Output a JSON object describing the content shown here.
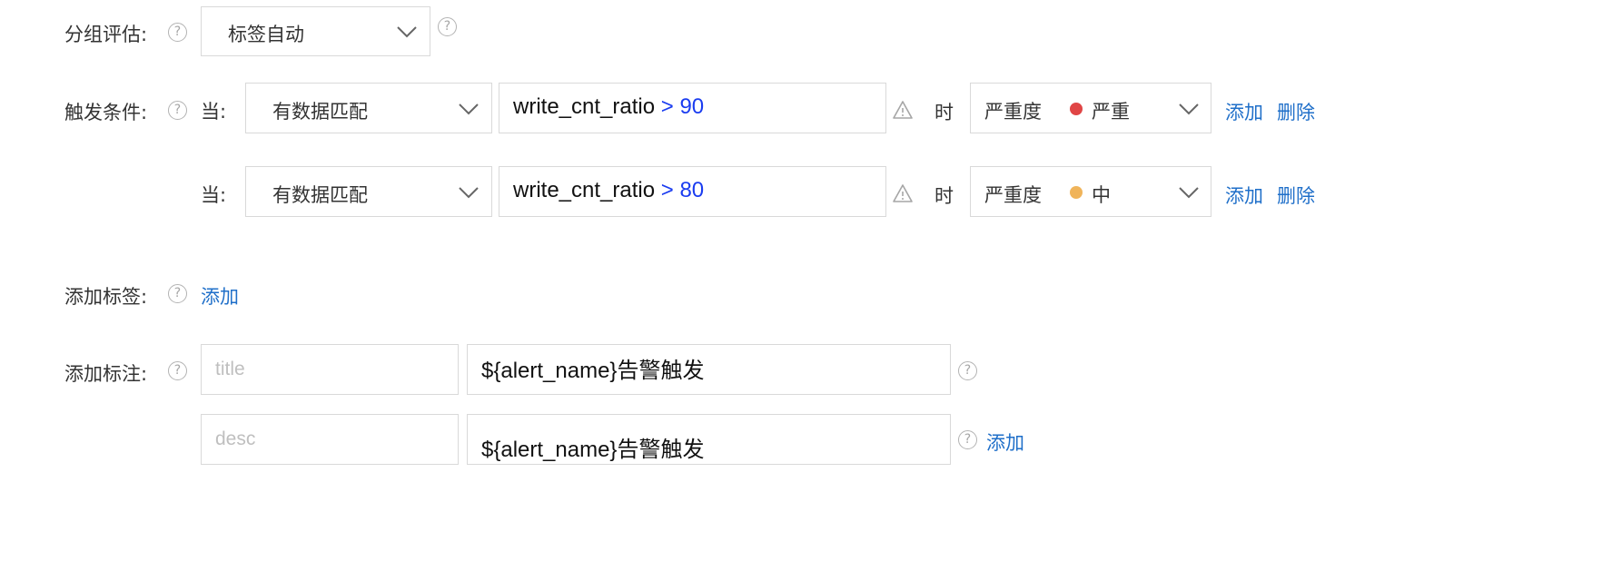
{
  "group_eval": {
    "label": "分组评估:",
    "help_icon": "?",
    "selected": "标签自动"
  },
  "trigger": {
    "label": "触发条件:",
    "help_icon": "?",
    "rows": [
      {
        "when_label": "当:",
        "match_mode": "有数据匹配",
        "expr_field": "write_cnt_ratio",
        "expr_op": ">",
        "expr_value": "90",
        "time_label": "时",
        "severity_prefix": "严重度",
        "severity": "严重",
        "severity_color": "#e04545",
        "add_label": "添加",
        "delete_label": "删除"
      },
      {
        "when_label": "当:",
        "match_mode": "有数据匹配",
        "expr_field": "write_cnt_ratio",
        "expr_op": ">",
        "expr_value": "80",
        "time_label": "时",
        "severity_prefix": "严重度",
        "severity": "中",
        "severity_color": "#f0b45a",
        "add_label": "添加",
        "delete_label": "删除"
      }
    ]
  },
  "add_tag": {
    "label": "添加标签:",
    "help_icon": "?",
    "add_label": "添加"
  },
  "add_annotation": {
    "label": "添加标注:",
    "help_icon": "?",
    "rows": [
      {
        "key_placeholder": "title",
        "value": "${alert_name}告警触发",
        "help_icon": "?"
      },
      {
        "key_placeholder": "desc",
        "value": "${alert_name}告警触发",
        "help_icon": "?",
        "add_label": "添加"
      }
    ]
  }
}
